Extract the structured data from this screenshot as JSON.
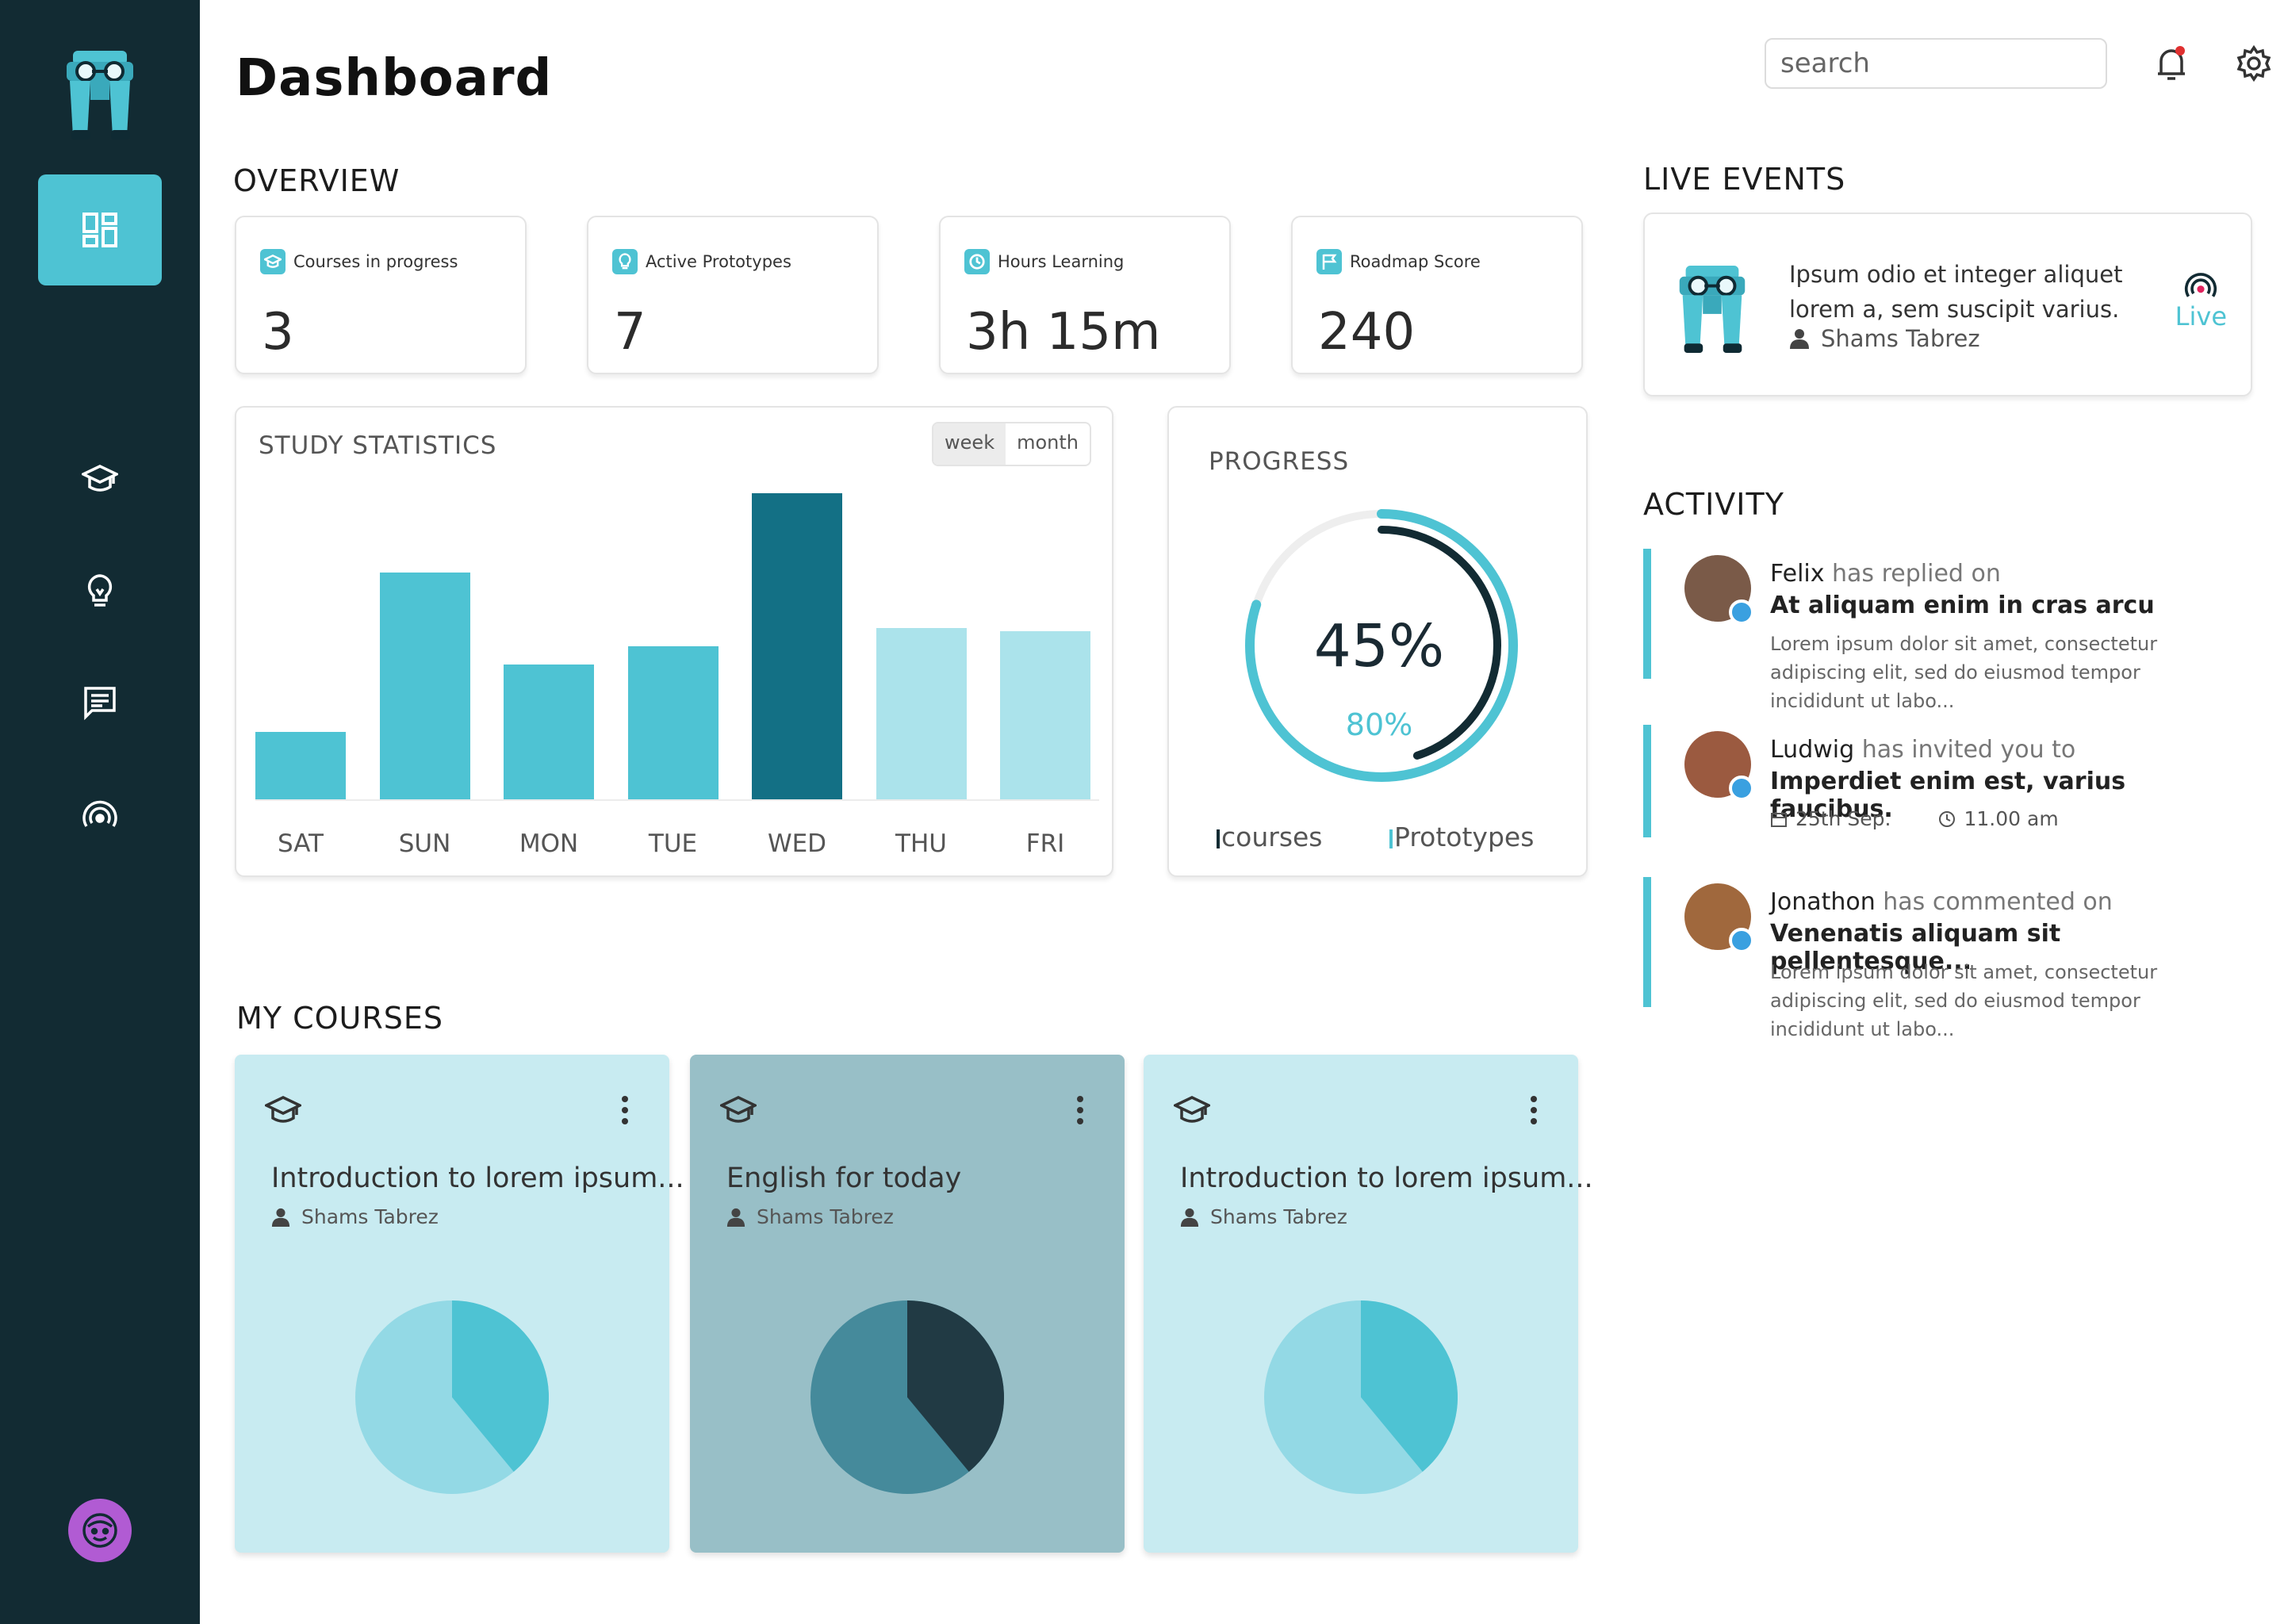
{
  "header": {
    "title": "Dashboard",
    "search_placeholder": "search"
  },
  "sidebar": {
    "items": [
      {
        "name": "dashboard",
        "icon": "grid-icon",
        "active": true
      },
      {
        "name": "courses",
        "icon": "graduation-cap-icon"
      },
      {
        "name": "prototypes",
        "icon": "lightbulb-icon"
      },
      {
        "name": "messages",
        "icon": "chat-icon"
      },
      {
        "name": "live",
        "icon": "broadcast-icon"
      }
    ]
  },
  "overview": {
    "title": "OVERVIEW",
    "cards": [
      {
        "label": "Courses in progress",
        "value": "3",
        "icon": "graduation-cap-icon"
      },
      {
        "label": "Active Prototypes",
        "value": "7",
        "icon": "lightbulb-icon"
      },
      {
        "label": "Hours Learning",
        "value": "3h 15m",
        "icon": "clock-icon"
      },
      {
        "label": "Roadmap Score",
        "value": "240",
        "icon": "flag-icon"
      }
    ]
  },
  "study": {
    "title": "STUDY STATISTICS",
    "toggle": {
      "week": "week",
      "month": "month",
      "selected": "week"
    }
  },
  "chart_data": {
    "type": "bar",
    "categories": [
      "SAT",
      "SUN",
      "MON",
      "TUE",
      "WED",
      "THU",
      "FRI"
    ],
    "values": [
      22,
      74,
      44,
      50,
      100,
      56,
      55
    ],
    "ylim": [
      0,
      100
    ],
    "colors": [
      "#4ec3d3",
      "#4ec3d3",
      "#4ec3d3",
      "#4ec3d3",
      "#137085",
      "#abe3eb",
      "#abe3eb"
    ],
    "title": "",
    "xlabel": "",
    "ylabel": ""
  },
  "progress": {
    "title": "PROGRESS",
    "primary": "45%",
    "secondary": "80%",
    "legend": [
      {
        "label": "courses",
        "color": "#122b33"
      },
      {
        "label": "Prototypes",
        "color": "#4ec3d3"
      }
    ],
    "courses_fraction": 0.45,
    "prototypes_fraction": 0.8
  },
  "live_events": {
    "title": "LIVE EVENTS",
    "text": "Ipsum odio et integer aliquet lorem a, sem suscipit varius.",
    "author": "Shams Tabrez",
    "status": "Live"
  },
  "activity": {
    "title": "ACTIVITY",
    "items": [
      {
        "name": "Felix",
        "action": " has replied on",
        "subject": "At aliquam enim in cras arcu",
        "desc": "Lorem ipsum dolor sit amet, consectetur adipiscing elit, sed do eiusmod tempor incididunt ut labo..."
      },
      {
        "name": "Ludwig",
        "action": " has invited you to",
        "subject": "Imperdiet enim est, varius faucibus.",
        "date": "25th Sep.",
        "time": "11.00 am"
      },
      {
        "name": "Jonathon",
        "action": " has commented on",
        "subject": "Venenatis aliquam sit pellentesque...",
        "desc": "Lorem ipsum dolor sit amet, consectetur adipiscing elit, sed do eiusmod tempor incididunt ut labo..."
      }
    ]
  },
  "my_courses": {
    "title": "MY COURSES",
    "items": [
      {
        "title": "Introduction to lorem ipsum...",
        "author": "Shams Tabrez",
        "bg": "#c8ebf1",
        "pie_dark": "#4ec3d3",
        "pie_light": "#93d9e5",
        "progress": 0.39
      },
      {
        "title": "English for today",
        "author": "Shams Tabrez",
        "bg": "#98bfc7",
        "pie_dark": "#213a44",
        "pie_light": "#458a9b",
        "progress": 0.39
      },
      {
        "title": "Introduction to lorem ipsum...",
        "author": "Shams Tabrez",
        "bg": "#c8ebf1",
        "pie_dark": "#4ec3d3",
        "pie_light": "#93d9e5",
        "progress": 0.39
      }
    ]
  }
}
